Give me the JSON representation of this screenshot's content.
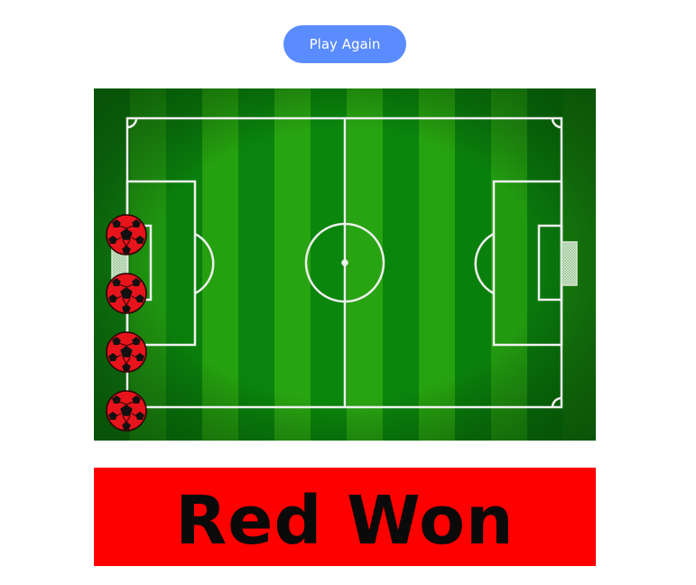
{
  "controls": {
    "play_again_label": "Play Again"
  },
  "game": {
    "result_text": "Red Won",
    "result_color": "#ff0000",
    "winner": "Red",
    "balls_remaining": 4,
    "ball_color": "#e8141c"
  },
  "colors": {
    "button": "#5b8cff",
    "pitch_dark": "#0c7a0c",
    "pitch_light": "#27a10f",
    "lines": "#f0f0f0"
  },
  "icons": {
    "ball": "soccer-ball-icon",
    "goal": "goal-net-icon"
  }
}
